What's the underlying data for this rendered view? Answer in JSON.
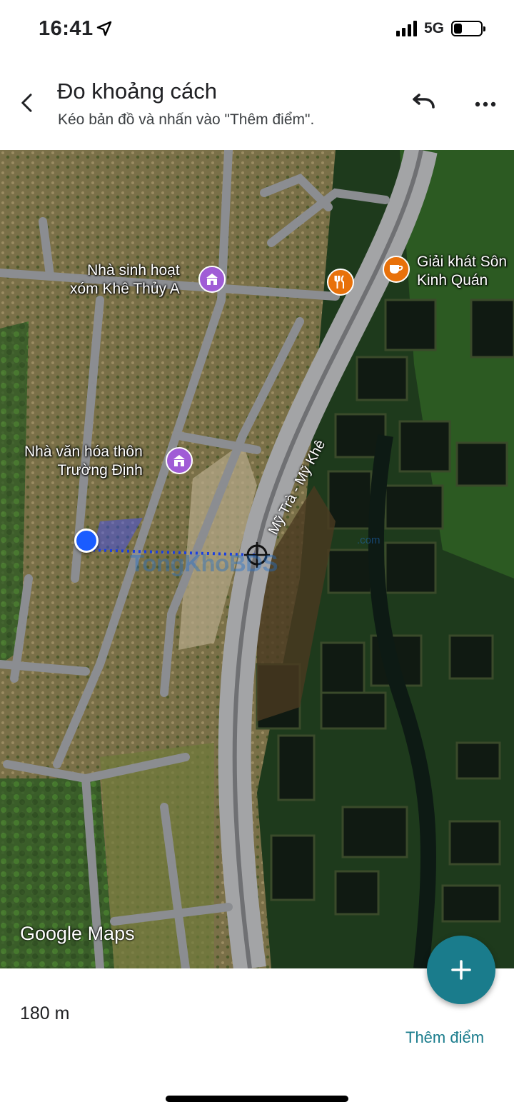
{
  "status_bar": {
    "time": "16:41",
    "network": "5G",
    "battery_level": 0.3
  },
  "header": {
    "title": "Đo khoảng cách",
    "subtitle": "Kéo bản đồ và nhấn vào \"Thêm điểm\"."
  },
  "icons": {
    "back": "arrow-back-icon",
    "undo": "undo-icon",
    "more": "more-horiz-icon",
    "location_arrow": "location-arrow-icon",
    "fab": "plus-icon"
  },
  "map": {
    "pois": [
      {
        "label_line1": "Nhà sinh hoạt",
        "label_line2": "xóm Khê Thủy A",
        "icon": "community-building-icon",
        "color": "#a05cd6"
      },
      {
        "label_line1": "Nhà văn hóa thôn",
        "label_line2": "Trường Định",
        "icon": "community-building-icon",
        "color": "#a05cd6"
      },
      {
        "label_line1": "",
        "label_line2": "",
        "icon": "restaurant-icon",
        "color": "#e8710a"
      },
      {
        "label_line1": "Giải khát Sôn",
        "label_line2": "Kinh Quán",
        "icon": "cafe-icon",
        "color": "#e8710a"
      }
    ],
    "road_label": "Mỹ Trà - Mỹ Khê",
    "watermark": "TongKhoBDS",
    "watermark_suffix": ".com",
    "attribution": "Google Maps"
  },
  "bottom": {
    "distance": "180 m",
    "add_point": "Thêm điểm"
  },
  "colors": {
    "accent": "#1a7c8c",
    "measure_line": "#1a3fe0",
    "poi_purple": "#a05cd6",
    "poi_orange": "#e8710a"
  }
}
